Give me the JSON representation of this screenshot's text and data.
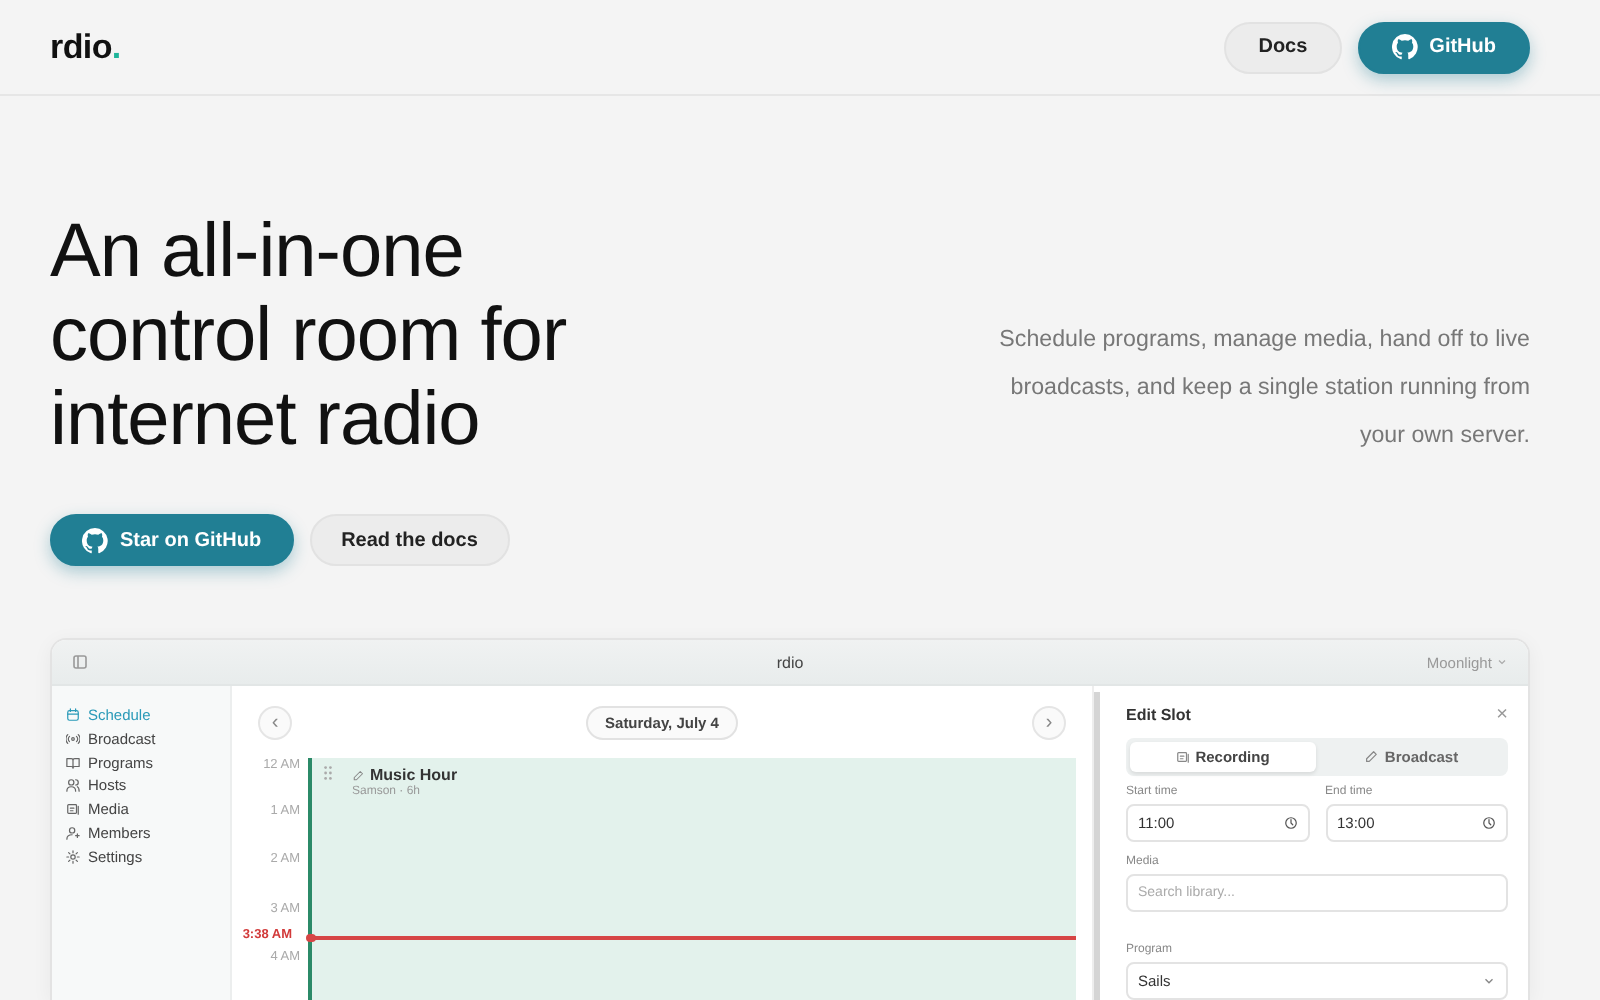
{
  "header": {
    "logo": "rdio",
    "logo_mark": ".",
    "nav": [
      {
        "label": "Docs",
        "kind": "ghost"
      },
      {
        "label": "GitHub",
        "kind": "primary"
      }
    ]
  },
  "hero": {
    "title_lines": [
      "An all-in-one",
      "control room for",
      "internet radio"
    ],
    "tagline": "Schedule programs, manage media, hand off to live broadcasts, and keep a single station running from your own server.",
    "actions": [
      {
        "label": "Star on GitHub",
        "kind": "primary"
      },
      {
        "label": "Read the docs",
        "kind": "ghost"
      }
    ]
  },
  "app": {
    "title": "rdio",
    "theme": "Moonlight",
    "sidebar": [
      {
        "label": "Schedule",
        "selected": true
      },
      {
        "label": "Broadcast",
        "selected": false
      },
      {
        "label": "Programs",
        "selected": false
      },
      {
        "label": "Hosts",
        "selected": false
      },
      {
        "label": "Media",
        "selected": false
      },
      {
        "label": "Members",
        "selected": false
      },
      {
        "label": "Settings",
        "selected": false
      }
    ],
    "date": "Saturday, July 4",
    "prev": "‹",
    "next": "›",
    "hours": [
      "12 AM",
      "1 AM",
      "2 AM",
      "3 AM",
      "4 AM"
    ],
    "now": {
      "label": "3:38 AM"
    },
    "event": {
      "title": "Music Hour",
      "meta": "Samson · 6h"
    },
    "panel": {
      "title": "Edit Slot",
      "close": "×",
      "modes": [
        {
          "label": "Recording",
          "selected": true
        },
        {
          "label": "Broadcast",
          "selected": false
        }
      ],
      "start": {
        "label": "Start time",
        "value": "11:00"
      },
      "end": {
        "label": "End time",
        "value": "13:00"
      },
      "media": {
        "label": "Media",
        "placeholder": "Search library..."
      },
      "program": {
        "label": "Program",
        "value": "Sails"
      }
    }
  }
}
